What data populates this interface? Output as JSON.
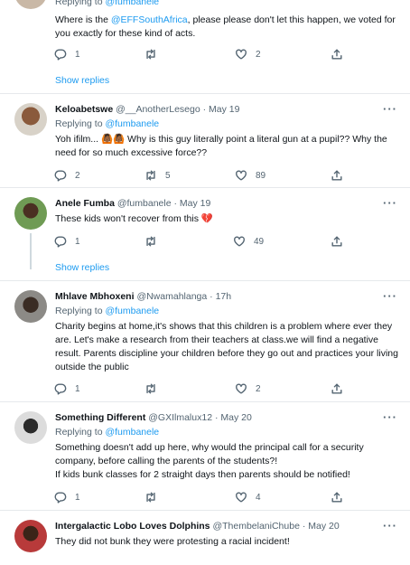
{
  "tweets": [
    {
      "reply_prefix": "Replying to ",
      "reply_handle": "@fumbanele",
      "text_pre": "Where is the ",
      "text_link": "@EFFSouthAfrica",
      "text_post": ", please please don't let this happen, we voted for you exactly for these kind of acts.",
      "replies": "1",
      "retweets": "",
      "likes": "2"
    },
    {
      "name": "Keloabetswe",
      "handle": "@__AnotherLesego",
      "date": "May 19",
      "reply_prefix": "Replying to ",
      "reply_handle": "@fumbanele",
      "text": "Yoh ifilm... 🙆🏾🙆🏾 Why is this guy literally point a literal gun at a pupil?? Why the need for so much excessive force??",
      "replies": "2",
      "retweets": "5",
      "likes": "89"
    },
    {
      "name": "Anele Fumba",
      "handle": "@fumbanele",
      "date": "May 19",
      "text": "These kids won't recover from this 💔",
      "replies": "1",
      "retweets": "",
      "likes": "49"
    },
    {
      "name": "Mhlave Mbhoxeni",
      "handle": "@Nwamahlanga",
      "date": "17h",
      "reply_prefix": "Replying to ",
      "reply_handle": "@fumbanele",
      "text": "Charity begins at home,it's shows that this children is a problem where ever they are. Let's make a research from their teachers at class.we will find a negative result. Parents discipline your children before they go out and practices your living outside the public",
      "replies": "1",
      "retweets": "",
      "likes": "2"
    },
    {
      "name": "Something Different",
      "handle": "@GXIlmalux12",
      "date": "May 20",
      "reply_prefix": "Replying to ",
      "reply_handle": "@fumbanele",
      "text": "Something doesn't add up here, why would the principal call for a security company, before calling the parents of the students?!\nIf kids bunk classes for 2 straight days then parents should be notified!",
      "replies": "1",
      "retweets": "",
      "likes": "4"
    },
    {
      "name": "Intergalactic Lobo Loves Dolphins",
      "handle": "@ThembelaniChube",
      "date": "May 20",
      "text": "They did not bunk they were protesting a racial incident!"
    }
  ],
  "separator": " · ",
  "show_replies_label": "Show replies",
  "more_label": "···",
  "colors": {
    "accent": "#1d9bf0",
    "muted": "#536471",
    "divider": "#e6e9ec"
  }
}
